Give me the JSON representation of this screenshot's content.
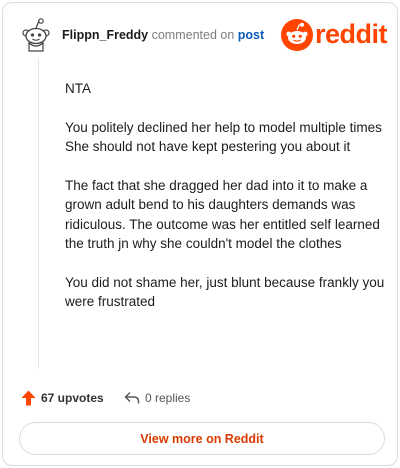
{
  "comment": {
    "username": "Flippn_Freddy",
    "action": "commented on",
    "target": "post",
    "paragraphs": [
      "NTA",
      "You politely declined her help to model multiple times She should not have kept pestering you about it",
      "The fact that she dragged her dad into it to make a grown adult bend to his daughters demands was ridiculous. The outcome was her entitled self learned the truth jn why she couldn't model the clothes",
      "You did not shame her, just blunt because frankly you were frustrated"
    ]
  },
  "brand": {
    "name": "reddit",
    "color": "#ff4500"
  },
  "footer": {
    "upvotes": "67 upvotes",
    "replies": "0 replies",
    "view_more": "View more on Reddit"
  },
  "icons": {
    "avatar": "snoo-avatar-icon",
    "logo": "reddit-snoo-icon",
    "upvote": "upvote-arrow-icon",
    "reply": "reply-arrow-icon"
  }
}
